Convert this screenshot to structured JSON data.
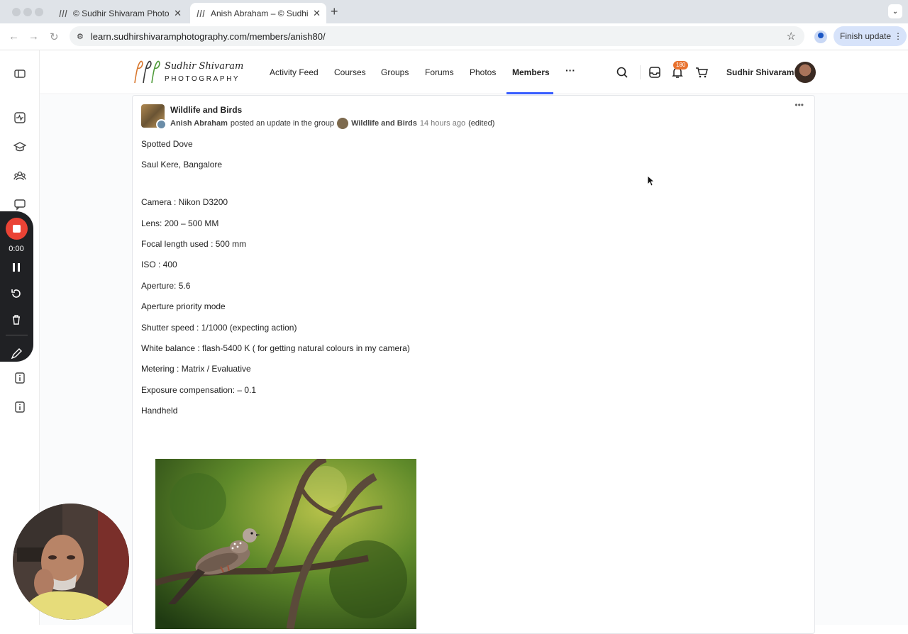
{
  "browser": {
    "tabs": [
      {
        "title": "© Sudhir Shivaram Photograp",
        "active": false
      },
      {
        "title": "Anish Abraham – © Sudhir Sh",
        "active": true
      }
    ],
    "url": "learn.sudhirshivaramphotography.com/members/anish80/",
    "finish_update_label": "Finish update"
  },
  "recorder": {
    "time": "0:00"
  },
  "site": {
    "logo_signature": "Sudhir Shivaram",
    "logo_subtitle": "PHOTOGRAPHY",
    "nav": [
      "Activity Feed",
      "Courses",
      "Groups",
      "Forums",
      "Photos",
      "Members"
    ],
    "active_nav": "Members",
    "notification_count": "180",
    "user_name": "Sudhir Shivaram"
  },
  "post": {
    "group_name": "Wildlife and Birds",
    "author": "Anish Abraham",
    "action_text": "posted an update in the group",
    "group_link": "Wildlife and Birds",
    "time_ago": "14 hours ago",
    "edited": "(edited)",
    "lines": [
      "Spotted Dove",
      "Saul Kere, Bangalore",
      "Camera : Nikon D3200",
      "Lens: 200 – 500 MM",
      "Focal length used : 500 mm",
      "ISO : 400",
      "Aperture: 5.6",
      "Aperture priority mode",
      "Shutter speed : 1/1000 (expecting action)",
      "White balance : flash-5400 K ( for getting natural colours in my camera)",
      "Metering : Matrix / Evaluative",
      "Exposure compensation: – 0.1",
      "Handheld"
    ]
  }
}
